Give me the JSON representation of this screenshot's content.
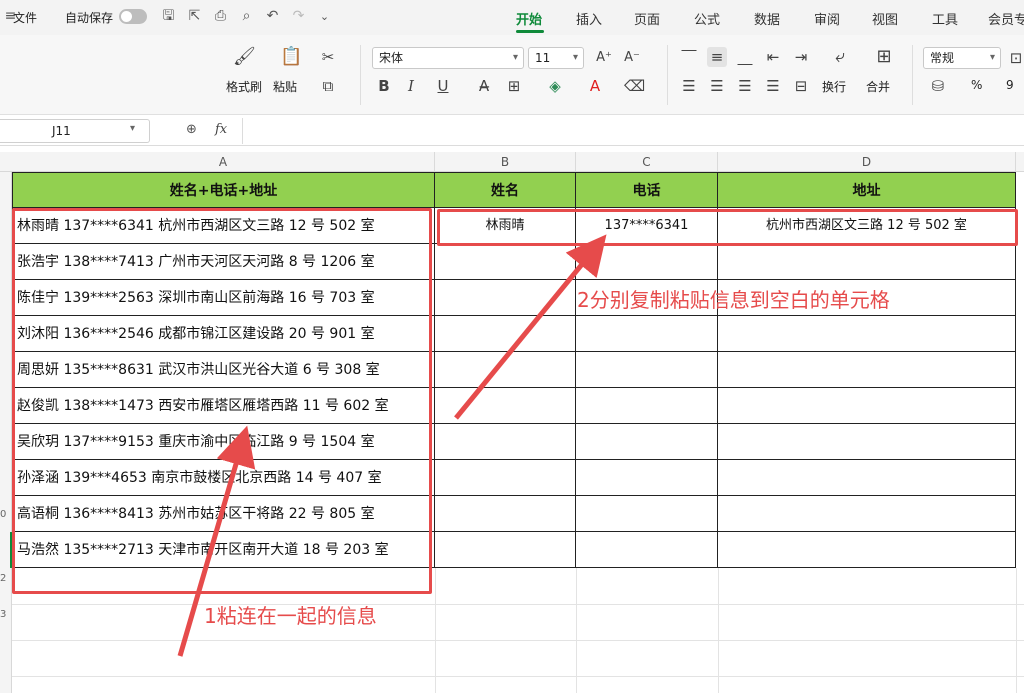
{
  "menubar": {
    "file_label": "文件",
    "autosave_label": "自动保存",
    "tabs": [
      "开始",
      "插入",
      "页面",
      "公式",
      "数据",
      "审阅",
      "视图",
      "工具",
      "会员专"
    ]
  },
  "ribbon": {
    "format_painter": "格式刷",
    "paste": "粘贴",
    "font_name": "宋体",
    "font_size": "11",
    "wrap": "换行",
    "merge": "合并",
    "number_format": "常规",
    "percent": "%",
    "thousands": "9"
  },
  "formula": {
    "cell_ref": "J11",
    "fx": "fx"
  },
  "columns": [
    "A",
    "B",
    "C",
    "D"
  ],
  "row_numbers": [
    "",
    "",
    "",
    "",
    "",
    "",
    "",
    "",
    "",
    "0",
    "",
    "2",
    "3",
    "",
    "",
    ""
  ],
  "table": {
    "headers": [
      "姓名+电话+地址",
      "姓名",
      "电话",
      "地址"
    ],
    "rows": [
      [
        "林雨晴 137****6341 杭州市西湖区文三路 12 号 502 室",
        "林雨晴",
        "137****6341",
        "杭州市西湖区文三路 12 号 502 室"
      ],
      [
        "张浩宇 138****7413 广州市天河区天河路 8 号 1206 室",
        "",
        "",
        ""
      ],
      [
        "陈佳宁 139****2563 深圳市南山区前海路 16 号 703 室",
        "",
        "",
        ""
      ],
      [
        "刘沐阳 136****2546 成都市锦江区建设路 20 号 901 室",
        "",
        "",
        ""
      ],
      [
        "周思妍 135****8631 武汉市洪山区光谷大道 6 号 308 室",
        "",
        "",
        ""
      ],
      [
        "赵俊凯 138****1473 西安市雁塔区雁塔西路 11 号 602 室",
        "",
        "",
        ""
      ],
      [
        "吴欣玥 137****9153 重庆市渝中区临江路 9 号 1504 室",
        "",
        "",
        ""
      ],
      [
        "孙泽涵 139***4653 南京市鼓楼区北京西路 14 号 407 室",
        "",
        "",
        ""
      ],
      [
        "高语桐 136****8413 苏州市姑苏区干将路 22 号 805 室",
        "",
        "",
        ""
      ],
      [
        "马浩然 135****2713 天津市南开区南开大道 18 号 203 室",
        "",
        "",
        ""
      ]
    ]
  },
  "annotations": {
    "step1": "1粘连在一起的信息",
    "step2": "2分别复制粘贴信息到空白的单元格"
  },
  "colors": {
    "accent": "#0f8a3a",
    "header_fill": "#92d050",
    "annotation": "#e64b4b"
  }
}
